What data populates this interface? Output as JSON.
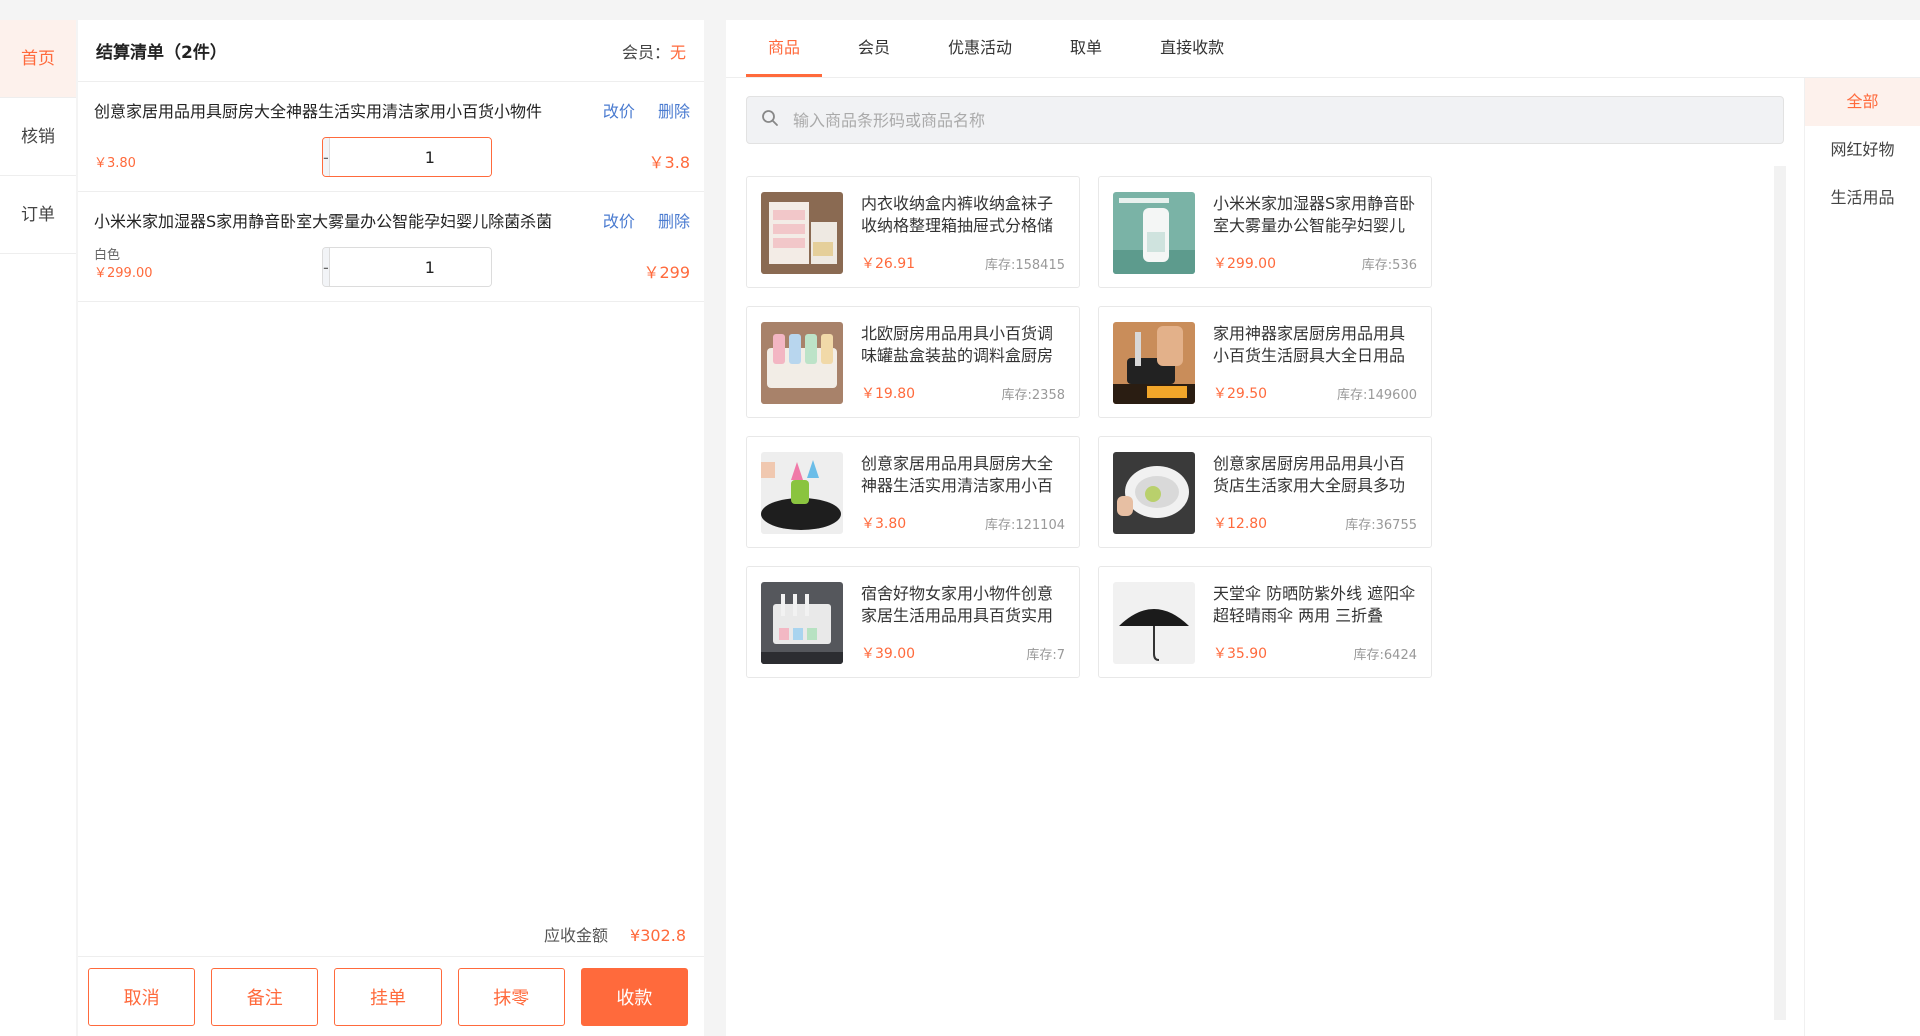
{
  "nav": {
    "items": [
      {
        "label": "首页",
        "active": true
      },
      {
        "label": "核销",
        "active": false
      },
      {
        "label": "订单",
        "active": false
      }
    ]
  },
  "cart": {
    "title": "结算清单（2件）",
    "member_label": "会员：",
    "member_value": "无",
    "items": [
      {
        "name": "创意家居用品用具厨房大全神器生活实用清洁家用小百货小物件",
        "spec": "",
        "unit_price": "￥3.80",
        "quantity": "1",
        "total": "￥3.8",
        "change_price": "改价",
        "delete": "删除"
      },
      {
        "name": "小米米家加湿器S家用静音卧室大雾量办公智能孕妇婴儿除菌杀菌",
        "spec": "白色",
        "unit_price": "￥299.00",
        "quantity": "1",
        "total": "￥299",
        "change_price": "改价",
        "delete": "删除"
      }
    ],
    "stepper_minus": "-",
    "stepper_plus": "+",
    "sum_label": "应收金额",
    "sum_value": "¥302.8",
    "buttons": {
      "cancel": "取消",
      "note": "备注",
      "hold": "挂单",
      "round": "抹零",
      "checkout": "收款"
    }
  },
  "tabs": [
    "商品",
    "会员",
    "优惠活动",
    "取单",
    "直接收款"
  ],
  "search": {
    "placeholder": "输入商品条形码或商品名称"
  },
  "products": [
    {
      "name": "内衣收纳盒内裤收纳盒袜子收纳格整理箱抽屉式分格储物盒",
      "price": "￥26.91",
      "stock": "库存:158415",
      "icon": "drawer-box-photo"
    },
    {
      "name": "小米米家加湿器S家用静音卧室大雾量办公智能孕妇婴儿",
      "price": "￥299.00",
      "stock": "库存:536",
      "icon": "humidifier-photo"
    },
    {
      "name": "北欧厨房用品用具小百货调味罐盐盒装盐的调料盒厨房套装",
      "price": "￥19.80",
      "stock": "库存:2358",
      "icon": "spice-box-photo"
    },
    {
      "name": "家用神器家居厨房用品用具小百货生活厨具大全日用品",
      "price": "￥29.50",
      "stock": "库存:149600",
      "icon": "knife-sharpener-photo"
    },
    {
      "name": "创意家居用品用具厨房大全神器生活实用清洁家用小百货",
      "price": "￥3.80",
      "stock": "库存:121104",
      "icon": "cleaning-brush-photo"
    },
    {
      "name": "创意家居厨房用品用具小百货店生活家用大全厨具多功能",
      "price": "￥12.80",
      "stock": "库存:36755",
      "icon": "drain-basket-photo"
    },
    {
      "name": "宿舍好物女家用小物件创意家居生活用品用具百货实用",
      "price": "￥39.00",
      "stock": "库存:7",
      "icon": "toothbrush-holder-photo"
    },
    {
      "name": "天堂伞 防晒防紫外线 遮阳伞 超轻晴雨伞 两用 三折叠",
      "price": "￥35.90",
      "stock": "库存:6424",
      "icon": "umbrella-photo"
    }
  ],
  "categories": [
    {
      "label": "全部",
      "active": true
    },
    {
      "label": "网红好物",
      "active": false
    },
    {
      "label": "生活用品",
      "active": false
    }
  ],
  "colors": {
    "accent": "#ff6a3c",
    "link": "#4a7bd0"
  }
}
